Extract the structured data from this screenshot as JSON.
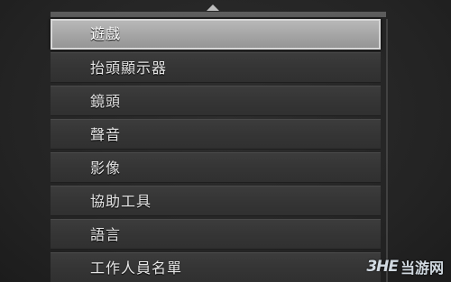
{
  "menu": {
    "items": [
      {
        "label": "遊戲",
        "selected": true
      },
      {
        "label": "抬頭顯示器",
        "selected": false
      },
      {
        "label": "鏡頭",
        "selected": false
      },
      {
        "label": "聲音",
        "selected": false
      },
      {
        "label": "影像",
        "selected": false
      },
      {
        "label": "協助工具",
        "selected": false
      },
      {
        "label": "語言",
        "selected": false
      },
      {
        "label": "工作人員名單",
        "selected": false
      }
    ]
  },
  "watermark": {
    "logo_mark": "3HE",
    "site_name": "当游网"
  },
  "icons": {
    "scroll_up": "triangle-up-icon"
  },
  "colors": {
    "background": "#272727",
    "item_background": "#353535",
    "selected_background": "#a6a6a6",
    "text": "#e6e6e6"
  }
}
